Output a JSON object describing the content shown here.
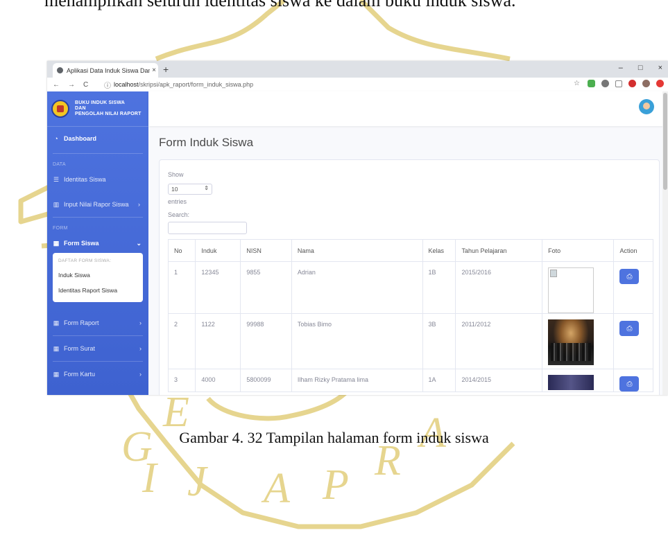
{
  "document": {
    "top_line": "menampilkan seluruh identitas siswa ke dalam buku induk siswa.",
    "caption": "Gambar 4. 32 Tampilan halaman form induk siswa",
    "watermark_text": [
      "E",
      "G",
      "I",
      "J",
      "A",
      "P",
      "R",
      "A"
    ]
  },
  "browser": {
    "tab_title": "Aplikasi Data Induk Siswa Dan N",
    "tab_close": "×",
    "new_tab": "+",
    "url_host": "localhost",
    "url_path": "/skripsi/apk_raport/form_induk_siswa.php",
    "window_controls": [
      "–",
      "□",
      "×"
    ],
    "nav": [
      "←",
      "→",
      "C"
    ]
  },
  "sidebar": {
    "brand_lines": [
      "BUKU INDUK SISWA",
      "DAN",
      "PENGOLAH NILAI RAPORT"
    ],
    "dashboard": "Dashboard",
    "section_data": "DATA",
    "identitas": "Identitas Siswa",
    "input_nilai": "Input Nilai Rapor Siswa",
    "section_form": "FORM",
    "form_siswa": "Form Siswa",
    "collapse_header": "DAFTAR FORM SISWA:",
    "collapse_items": [
      "Induk Siswa",
      "Identitas Raport Siswa"
    ],
    "form_raport": "Form Raport",
    "form_surat": "Form Surat",
    "form_kartu": "Form Kartu"
  },
  "main": {
    "page_title": "Form Induk Siswa",
    "show_label": "Show",
    "entries_value": "10",
    "entries_label": "entries",
    "search_label": "Search:"
  },
  "table": {
    "headers": [
      "No",
      "Induk",
      "NISN",
      "Nama",
      "Kelas",
      "Tahun Pelajaran",
      "Foto",
      "Action"
    ],
    "rows": [
      {
        "no": "1",
        "induk": "12345",
        "nisn": "9855",
        "nama": "Adrian",
        "kelas": "1B",
        "tahun": "2015/2016"
      },
      {
        "no": "2",
        "induk": "1122",
        "nisn": "99988",
        "nama": "Tobias Bimo",
        "kelas": "3B",
        "tahun": "2011/2012"
      },
      {
        "no": "3",
        "induk": "4000",
        "nisn": "5800099",
        "nama": "Ilham Rizky Pratama lima",
        "kelas": "1A",
        "tahun": "2014/2015"
      }
    ]
  },
  "colors": {
    "sidebar": "#4e73df",
    "print_button": "#4e73df",
    "watermark": "#e6d58f"
  }
}
